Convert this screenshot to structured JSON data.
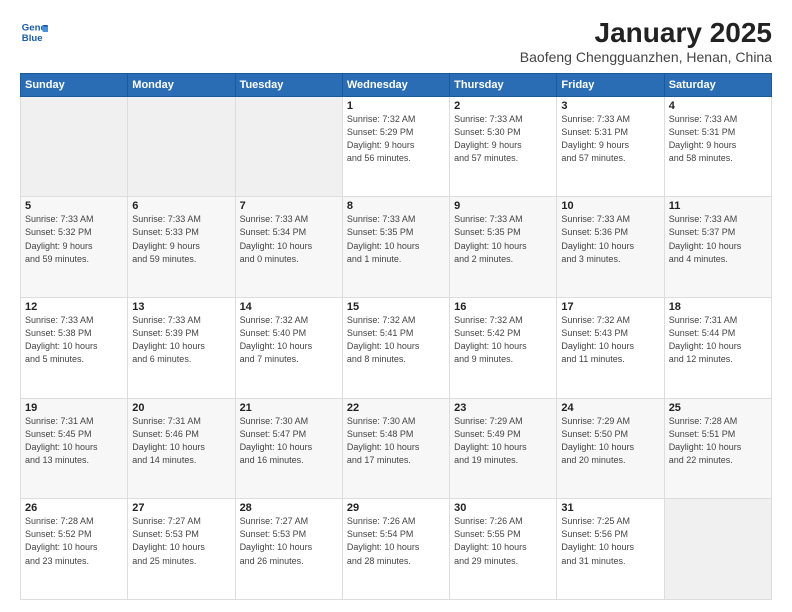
{
  "header": {
    "logo_line1": "General",
    "logo_line2": "Blue",
    "title": "January 2025",
    "subtitle": "Baofeng Chengguanzhen, Henan, China"
  },
  "days_of_week": [
    "Sunday",
    "Monday",
    "Tuesday",
    "Wednesday",
    "Thursday",
    "Friday",
    "Saturday"
  ],
  "weeks": [
    [
      {
        "day": "",
        "info": ""
      },
      {
        "day": "",
        "info": ""
      },
      {
        "day": "",
        "info": ""
      },
      {
        "day": "1",
        "info": "Sunrise: 7:32 AM\nSunset: 5:29 PM\nDaylight: 9 hours\nand 56 minutes."
      },
      {
        "day": "2",
        "info": "Sunrise: 7:33 AM\nSunset: 5:30 PM\nDaylight: 9 hours\nand 57 minutes."
      },
      {
        "day": "3",
        "info": "Sunrise: 7:33 AM\nSunset: 5:31 PM\nDaylight: 9 hours\nand 57 minutes."
      },
      {
        "day": "4",
        "info": "Sunrise: 7:33 AM\nSunset: 5:31 PM\nDaylight: 9 hours\nand 58 minutes."
      }
    ],
    [
      {
        "day": "5",
        "info": "Sunrise: 7:33 AM\nSunset: 5:32 PM\nDaylight: 9 hours\nand 59 minutes."
      },
      {
        "day": "6",
        "info": "Sunrise: 7:33 AM\nSunset: 5:33 PM\nDaylight: 9 hours\nand 59 minutes."
      },
      {
        "day": "7",
        "info": "Sunrise: 7:33 AM\nSunset: 5:34 PM\nDaylight: 10 hours\nand 0 minutes."
      },
      {
        "day": "8",
        "info": "Sunrise: 7:33 AM\nSunset: 5:35 PM\nDaylight: 10 hours\nand 1 minute."
      },
      {
        "day": "9",
        "info": "Sunrise: 7:33 AM\nSunset: 5:35 PM\nDaylight: 10 hours\nand 2 minutes."
      },
      {
        "day": "10",
        "info": "Sunrise: 7:33 AM\nSunset: 5:36 PM\nDaylight: 10 hours\nand 3 minutes."
      },
      {
        "day": "11",
        "info": "Sunrise: 7:33 AM\nSunset: 5:37 PM\nDaylight: 10 hours\nand 4 minutes."
      }
    ],
    [
      {
        "day": "12",
        "info": "Sunrise: 7:33 AM\nSunset: 5:38 PM\nDaylight: 10 hours\nand 5 minutes."
      },
      {
        "day": "13",
        "info": "Sunrise: 7:33 AM\nSunset: 5:39 PM\nDaylight: 10 hours\nand 6 minutes."
      },
      {
        "day": "14",
        "info": "Sunrise: 7:32 AM\nSunset: 5:40 PM\nDaylight: 10 hours\nand 7 minutes."
      },
      {
        "day": "15",
        "info": "Sunrise: 7:32 AM\nSunset: 5:41 PM\nDaylight: 10 hours\nand 8 minutes."
      },
      {
        "day": "16",
        "info": "Sunrise: 7:32 AM\nSunset: 5:42 PM\nDaylight: 10 hours\nand 9 minutes."
      },
      {
        "day": "17",
        "info": "Sunrise: 7:32 AM\nSunset: 5:43 PM\nDaylight: 10 hours\nand 11 minutes."
      },
      {
        "day": "18",
        "info": "Sunrise: 7:31 AM\nSunset: 5:44 PM\nDaylight: 10 hours\nand 12 minutes."
      }
    ],
    [
      {
        "day": "19",
        "info": "Sunrise: 7:31 AM\nSunset: 5:45 PM\nDaylight: 10 hours\nand 13 minutes."
      },
      {
        "day": "20",
        "info": "Sunrise: 7:31 AM\nSunset: 5:46 PM\nDaylight: 10 hours\nand 14 minutes."
      },
      {
        "day": "21",
        "info": "Sunrise: 7:30 AM\nSunset: 5:47 PM\nDaylight: 10 hours\nand 16 minutes."
      },
      {
        "day": "22",
        "info": "Sunrise: 7:30 AM\nSunset: 5:48 PM\nDaylight: 10 hours\nand 17 minutes."
      },
      {
        "day": "23",
        "info": "Sunrise: 7:29 AM\nSunset: 5:49 PM\nDaylight: 10 hours\nand 19 minutes."
      },
      {
        "day": "24",
        "info": "Sunrise: 7:29 AM\nSunset: 5:50 PM\nDaylight: 10 hours\nand 20 minutes."
      },
      {
        "day": "25",
        "info": "Sunrise: 7:28 AM\nSunset: 5:51 PM\nDaylight: 10 hours\nand 22 minutes."
      }
    ],
    [
      {
        "day": "26",
        "info": "Sunrise: 7:28 AM\nSunset: 5:52 PM\nDaylight: 10 hours\nand 23 minutes."
      },
      {
        "day": "27",
        "info": "Sunrise: 7:27 AM\nSunset: 5:53 PM\nDaylight: 10 hours\nand 25 minutes."
      },
      {
        "day": "28",
        "info": "Sunrise: 7:27 AM\nSunset: 5:53 PM\nDaylight: 10 hours\nand 26 minutes."
      },
      {
        "day": "29",
        "info": "Sunrise: 7:26 AM\nSunset: 5:54 PM\nDaylight: 10 hours\nand 28 minutes."
      },
      {
        "day": "30",
        "info": "Sunrise: 7:26 AM\nSunset: 5:55 PM\nDaylight: 10 hours\nand 29 minutes."
      },
      {
        "day": "31",
        "info": "Sunrise: 7:25 AM\nSunset: 5:56 PM\nDaylight: 10 hours\nand 31 minutes."
      },
      {
        "day": "",
        "info": ""
      }
    ]
  ]
}
